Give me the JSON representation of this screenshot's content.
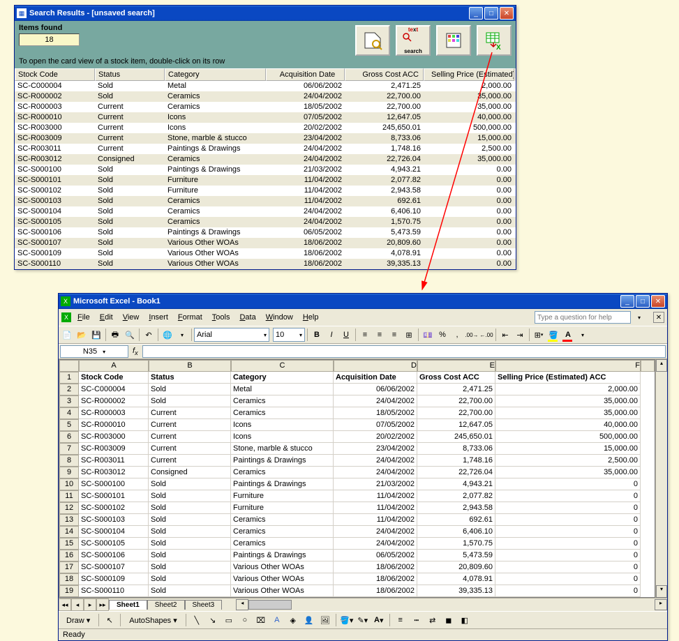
{
  "search_window": {
    "title": "Search Results - [unsaved search]",
    "items_found_label": "Items found",
    "items_found_value": "18",
    "hint": "To open the card view of a stock item, double-click on its row",
    "columns": [
      "Stock Code",
      "Status",
      "Category",
      "Acquisition Date",
      "Gross Cost ACC",
      "Selling Price (Estimated) ACC"
    ],
    "rows": [
      {
        "code": "SC-C000004",
        "status": "Sold",
        "cat": "Metal",
        "acq": "06/06/2002",
        "gc": "2,471.25",
        "sp": "2,000.00"
      },
      {
        "code": "SC-R000002",
        "status": "Sold",
        "cat": "Ceramics",
        "acq": "24/04/2002",
        "gc": "22,700.00",
        "sp": "35,000.00"
      },
      {
        "code": "SC-R000003",
        "status": "Current",
        "cat": "Ceramics",
        "acq": "18/05/2002",
        "gc": "22,700.00",
        "sp": "35,000.00"
      },
      {
        "code": "SC-R000010",
        "status": "Current",
        "cat": "Icons",
        "acq": "07/05/2002",
        "gc": "12,647.05",
        "sp": "40,000.00"
      },
      {
        "code": "SC-R003000",
        "status": "Current",
        "cat": "Icons",
        "acq": "20/02/2002",
        "gc": "245,650.01",
        "sp": "500,000.00"
      },
      {
        "code": "SC-R003009",
        "status": "Current",
        "cat": "Stone, marble & stucco",
        "acq": "23/04/2002",
        "gc": "8,733.06",
        "sp": "15,000.00"
      },
      {
        "code": "SC-R003011",
        "status": "Current",
        "cat": "Paintings & Drawings",
        "acq": "24/04/2002",
        "gc": "1,748.16",
        "sp": "2,500.00"
      },
      {
        "code": "SC-R003012",
        "status": "Consigned",
        "cat": "Ceramics",
        "acq": "24/04/2002",
        "gc": "22,726.04",
        "sp": "35,000.00"
      },
      {
        "code": "SC-S000100",
        "status": "Sold",
        "cat": "Paintings & Drawings",
        "acq": "21/03/2002",
        "gc": "4,943.21",
        "sp": "0.00"
      },
      {
        "code": "SC-S000101",
        "status": "Sold",
        "cat": "Furniture",
        "acq": "11/04/2002",
        "gc": "2,077.82",
        "sp": "0.00"
      },
      {
        "code": "SC-S000102",
        "status": "Sold",
        "cat": "Furniture",
        "acq": "11/04/2002",
        "gc": "2,943.58",
        "sp": "0.00"
      },
      {
        "code": "SC-S000103",
        "status": "Sold",
        "cat": "Ceramics",
        "acq": "11/04/2002",
        "gc": "692.61",
        "sp": "0.00"
      },
      {
        "code": "SC-S000104",
        "status": "Sold",
        "cat": "Ceramics",
        "acq": "24/04/2002",
        "gc": "6,406.10",
        "sp": "0.00"
      },
      {
        "code": "SC-S000105",
        "status": "Sold",
        "cat": "Ceramics",
        "acq": "24/04/2002",
        "gc": "1,570.75",
        "sp": "0.00"
      },
      {
        "code": "SC-S000106",
        "status": "Sold",
        "cat": "Paintings & Drawings",
        "acq": "06/05/2002",
        "gc": "5,473.59",
        "sp": "0.00"
      },
      {
        "code": "SC-S000107",
        "status": "Sold",
        "cat": "Various Other WOAs",
        "acq": "18/06/2002",
        "gc": "20,809.60",
        "sp": "0.00"
      },
      {
        "code": "SC-S000109",
        "status": "Sold",
        "cat": "Various Other WOAs",
        "acq": "18/06/2002",
        "gc": "4,078.91",
        "sp": "0.00"
      },
      {
        "code": "SC-S000110",
        "status": "Sold",
        "cat": "Various Other WOAs",
        "acq": "18/06/2002",
        "gc": "39,335.13",
        "sp": "0.00"
      }
    ],
    "btn_search_label": "text search"
  },
  "excel": {
    "title": "Microsoft Excel - Book1",
    "menu": [
      "File",
      "Edit",
      "View",
      "Insert",
      "Format",
      "Tools",
      "Data",
      "Window",
      "Help"
    ],
    "help_placeholder": "Type a question for help",
    "font": "Arial",
    "size": "10",
    "namebox": "N35",
    "col_letters": [
      "A",
      "B",
      "C",
      "D",
      "E",
      "F"
    ],
    "header_row": [
      "Stock Code",
      "Status",
      "Category",
      "Acquisition Date",
      "Gross Cost ACC",
      "Selling Price (Estimated) ACC"
    ],
    "rows": [
      {
        "n": "2",
        "a": "SC-C000004",
        "b": "Sold",
        "c": "Metal",
        "d": "06/06/2002",
        "e": "2,471.25",
        "f": "2,000.00"
      },
      {
        "n": "3",
        "a": "SC-R000002",
        "b": "Sold",
        "c": "Ceramics",
        "d": "24/04/2002",
        "e": "22,700.00",
        "f": "35,000.00"
      },
      {
        "n": "4",
        "a": "SC-R000003",
        "b": "Current",
        "c": "Ceramics",
        "d": "18/05/2002",
        "e": "22,700.00",
        "f": "35,000.00"
      },
      {
        "n": "5",
        "a": "SC-R000010",
        "b": "Current",
        "c": "Icons",
        "d": "07/05/2002",
        "e": "12,647.05",
        "f": "40,000.00"
      },
      {
        "n": "6",
        "a": "SC-R003000",
        "b": "Current",
        "c": "Icons",
        "d": "20/02/2002",
        "e": "245,650.01",
        "f": "500,000.00"
      },
      {
        "n": "7",
        "a": "SC-R003009",
        "b": "Current",
        "c": "Stone, marble & stucco",
        "d": "23/04/2002",
        "e": "8,733.06",
        "f": "15,000.00"
      },
      {
        "n": "8",
        "a": "SC-R003011",
        "b": "Current",
        "c": "Paintings & Drawings",
        "d": "24/04/2002",
        "e": "1,748.16",
        "f": "2,500.00"
      },
      {
        "n": "9",
        "a": "SC-R003012",
        "b": "Consigned",
        "c": "Ceramics",
        "d": "24/04/2002",
        "e": "22,726.04",
        "f": "35,000.00"
      },
      {
        "n": "10",
        "a": "SC-S000100",
        "b": "Sold",
        "c": "Paintings & Drawings",
        "d": "21/03/2002",
        "e": "4,943.21",
        "f": "0"
      },
      {
        "n": "11",
        "a": "SC-S000101",
        "b": "Sold",
        "c": "Furniture",
        "d": "11/04/2002",
        "e": "2,077.82",
        "f": "0"
      },
      {
        "n": "12",
        "a": "SC-S000102",
        "b": "Sold",
        "c": "Furniture",
        "d": "11/04/2002",
        "e": "2,943.58",
        "f": "0"
      },
      {
        "n": "13",
        "a": "SC-S000103",
        "b": "Sold",
        "c": "Ceramics",
        "d": "11/04/2002",
        "e": "692.61",
        "f": "0"
      },
      {
        "n": "14",
        "a": "SC-S000104",
        "b": "Sold",
        "c": "Ceramics",
        "d": "24/04/2002",
        "e": "6,406.10",
        "f": "0"
      },
      {
        "n": "15",
        "a": "SC-S000105",
        "b": "Sold",
        "c": "Ceramics",
        "d": "24/04/2002",
        "e": "1,570.75",
        "f": "0"
      },
      {
        "n": "16",
        "a": "SC-S000106",
        "b": "Sold",
        "c": "Paintings & Drawings",
        "d": "06/05/2002",
        "e": "5,473.59",
        "f": "0"
      },
      {
        "n": "17",
        "a": "SC-S000107",
        "b": "Sold",
        "c": "Various Other WOAs",
        "d": "18/06/2002",
        "e": "20,809.60",
        "f": "0"
      },
      {
        "n": "18",
        "a": "SC-S000109",
        "b": "Sold",
        "c": "Various Other WOAs",
        "d": "18/06/2002",
        "e": "4,078.91",
        "f": "0"
      },
      {
        "n": "19",
        "a": "SC-S000110",
        "b": "Sold",
        "c": "Various Other WOAs",
        "d": "18/06/2002",
        "e": "39,335.13",
        "f": "0"
      }
    ],
    "sheets": [
      "Sheet1",
      "Sheet2",
      "Sheet3"
    ],
    "draw_label": "Draw",
    "autoshapes_label": "AutoShapes",
    "status": "Ready"
  }
}
